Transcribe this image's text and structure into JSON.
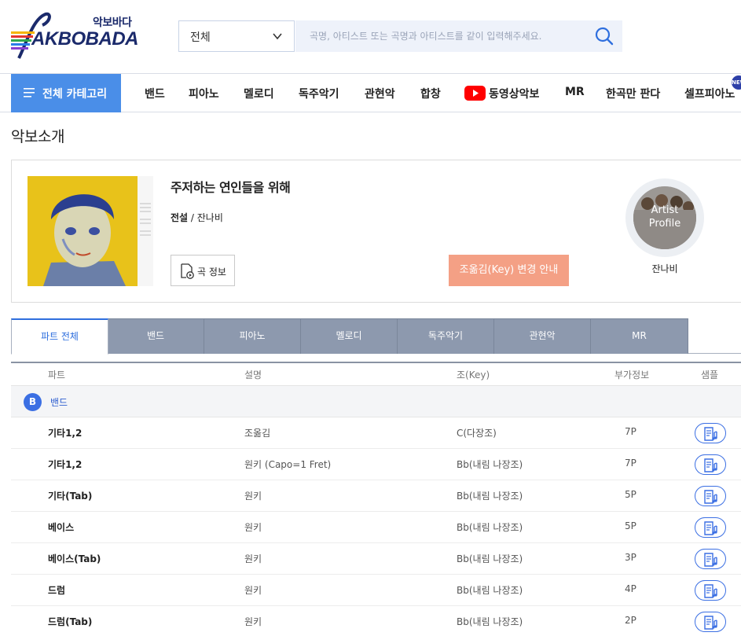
{
  "header": {
    "logo_small": "악보바다",
    "logo_main": "AKBOBADA",
    "search_select_value": "전체",
    "search_placeholder": "곡명, 아티스트 또는 곡명과 아티스트를 같이 입력해주세요."
  },
  "nav": {
    "category_label": "전체 카테고리",
    "items": [
      "밴드",
      "피아노",
      "멜로디",
      "독주악기",
      "관현악",
      "합창",
      "동영상악보",
      "MR",
      "한곡만 판다",
      "셀프피아노"
    ],
    "new_badge": "NEW"
  },
  "section_title": "악보소개",
  "song": {
    "title": "주저하는 연인들을 위해",
    "artist": "전설",
    "artist_sep": " / ",
    "artist_name": "잔나비",
    "info_button": "곡 정보",
    "key_button": "조옮김(Key) 변경 안내",
    "artist_profile_label_1": "Artist",
    "artist_profile_label_2": "Profile",
    "artist_profile_name": "잔나비"
  },
  "tabs": [
    "파트 전체",
    "밴드",
    "피아노",
    "멜로디",
    "독주악기",
    "관현악",
    "MR"
  ],
  "active_tab": 0,
  "table": {
    "headers": [
      "파트",
      "설명",
      "조(Key)",
      "부가정보",
      "샘플"
    ],
    "group": {
      "badge": "B",
      "label": "밴드"
    },
    "rows": [
      {
        "part": "기타1,2",
        "desc": "조옮김",
        "key": "C(다장조)",
        "pages": "7P"
      },
      {
        "part": "기타1,2",
        "desc": "원키 (Capo=1 Fret)",
        "key": "Bb(내림 나장조)",
        "pages": "7P"
      },
      {
        "part": "기타(Tab)",
        "desc": "원키",
        "key": "Bb(내림 나장조)",
        "pages": "5P"
      },
      {
        "part": "베이스",
        "desc": "원키",
        "key": "Bb(내림 나장조)",
        "pages": "5P"
      },
      {
        "part": "베이스(Tab)",
        "desc": "원키",
        "key": "Bb(내림 나장조)",
        "pages": "3P"
      },
      {
        "part": "드럼",
        "desc": "원키",
        "key": "Bb(내림 나장조)",
        "pages": "4P"
      },
      {
        "part": "드럼(Tab)",
        "desc": "원키",
        "key": "Bb(내림 나장조)",
        "pages": "2P"
      }
    ]
  },
  "colors": {
    "accent_blue": "#4a8ee8",
    "key_button": "#f4a085",
    "tab_inactive": "#8d99ae",
    "badge_blue": "#3b6fe3"
  }
}
